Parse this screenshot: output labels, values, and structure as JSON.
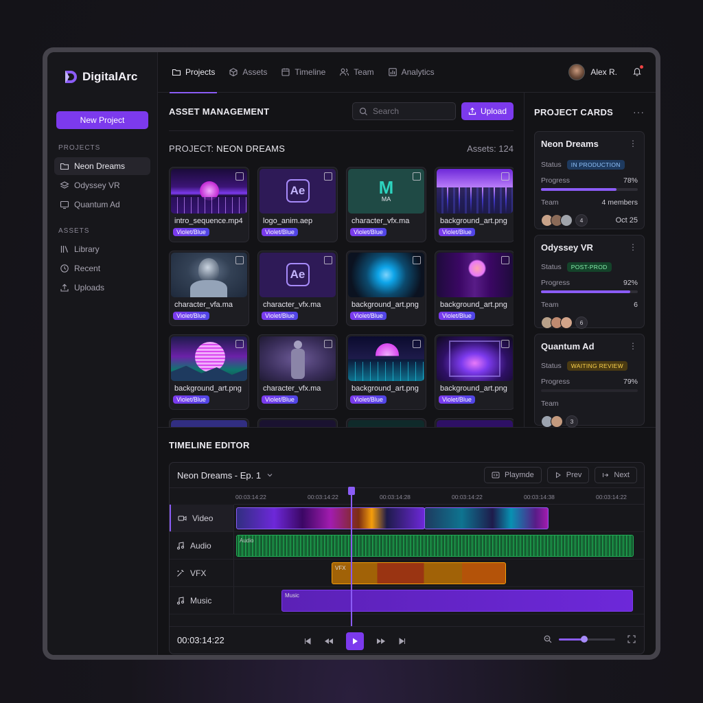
{
  "app": {
    "name": "DigitalArc"
  },
  "sidebar": {
    "new_project": "New Project",
    "projects_label": "PROJECTS",
    "projects": [
      "Neon Dreams",
      "Odyssey VR",
      "Quantum Ad"
    ],
    "assets_label": "ASSETS",
    "assets": [
      "Library",
      "Recent",
      "Uploads"
    ]
  },
  "tabs": [
    "Projects",
    "Assets",
    "Timeline",
    "Team",
    "Analytics"
  ],
  "user": {
    "name": "Alex R."
  },
  "asset_management": {
    "title": "ASSET MANAGEMENT",
    "search_placeholder": "Search",
    "upload": "Upload",
    "project_prefix": "PROJECT:",
    "project_name": "NEON DREAMS",
    "assets_count": "Assets: 124",
    "cards": [
      {
        "name": "intro_sequence.mp4",
        "tag": "Violet/Blue"
      },
      {
        "name": "logo_anim.aep",
        "tag": "Violet/Blue",
        "icon": "Ae"
      },
      {
        "name": "character_vfx.ma",
        "tag": "Violet/Blue",
        "icon": "MA"
      },
      {
        "name": "background_art.png",
        "tag": "Violet/Blue"
      },
      {
        "name": "character_vfa.ma",
        "tag": "Violet/Blue"
      },
      {
        "name": "character_vfx.ma",
        "tag": "Violet/Blue",
        "icon": "Ae"
      },
      {
        "name": "background_art.png",
        "tag": "Violet/Blue"
      },
      {
        "name": "background_art.png",
        "tag": "Violet/Blue"
      },
      {
        "name": "background_art.png",
        "tag": "Violet/Blue"
      },
      {
        "name": "character_vfx.ma",
        "tag": "Violet/Blue"
      },
      {
        "name": "background_art.png",
        "tag": "Violet/Blue"
      },
      {
        "name": "background_art.png",
        "tag": "Violet/Blue"
      }
    ]
  },
  "timeline": {
    "title": "TIMELINE EDITOR",
    "sequence": "Neon Dreams - Ep. 1",
    "playmode": "Playmde",
    "prev": "Prev",
    "next": "Next",
    "ruler": [
      "00:03:14:22",
      "00:03:14:22",
      "00:03:14:28",
      "00:03:14:22",
      "00:03:14:38",
      "00:03:14:22"
    ],
    "tracks": [
      "Video",
      "Audio",
      "VFX",
      "Music"
    ],
    "clip_labels": {
      "audio": "Audio",
      "vfx": "VFX",
      "music": "Music"
    },
    "timecode": "00:03:14:22",
    "zoom_level": 0.45
  },
  "project_cards": {
    "title": "PROJECT CARDS",
    "status_label": "Status",
    "progress_label": "Progress",
    "team_label": "Team",
    "cards": [
      {
        "name": "Neon Dreams",
        "status": "IN PRODUCTION",
        "status_color": "#93c5fd",
        "status_bg": "#1e3a5f",
        "progress": "78%",
        "progress_value": 0.78,
        "team": "4 members",
        "count": "4",
        "date": "Oct 25"
      },
      {
        "name": "Odyssey VR",
        "status": "POST-PROD",
        "status_color": "#86efac",
        "status_bg": "#14432a",
        "progress": "92%",
        "progress_value": 0.92,
        "team": "6",
        "count": "6",
        "date": ""
      },
      {
        "name": "Quantum Ad",
        "status": "WAITING REVIEW",
        "status_color": "#fcd34d",
        "status_bg": "#4a3a12",
        "progress": "79%",
        "progress_value": 0.79,
        "team": "",
        "count": "3",
        "date": ""
      }
    ]
  }
}
